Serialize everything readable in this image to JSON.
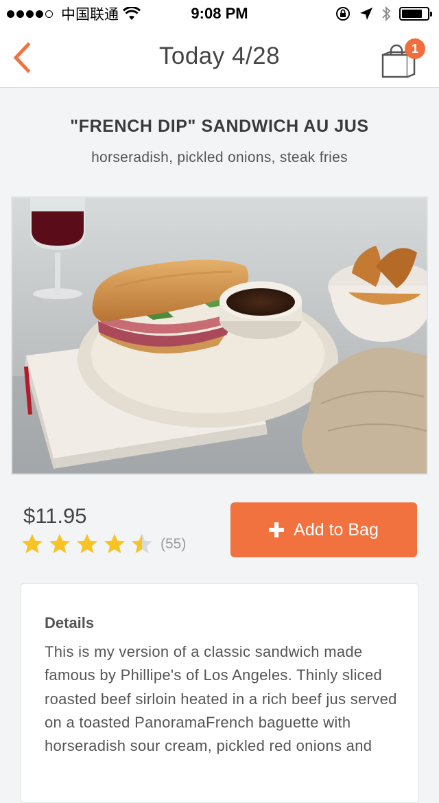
{
  "status_bar": {
    "carrier": "中国联通",
    "time": "9:08 PM",
    "signal_bars_filled": 4,
    "signal_bars_total": 5,
    "battery_level": 0.8
  },
  "nav": {
    "title": "Today 4/28",
    "back_icon": "chevron-left-icon",
    "bag_icon": "shopping-bag-icon",
    "bag_count": "1"
  },
  "dish": {
    "name": "\"FRENCH DIP\" SANDWICH AU JUS",
    "subtitle": "horseradish, pickled onions, steak fries",
    "price": "$11.95",
    "rating_value": 4.5,
    "rating_max": 5,
    "rating_count": "(55)"
  },
  "actions": {
    "add_to_bag_label": "Add to Bag"
  },
  "details": {
    "heading": "Details",
    "body": "This is my version of a classic sandwich made famous by Phillipe's of Los Angeles. Thinly sliced roasted beef sirloin heated in a rich beef jus served on a toasted PanoramaFrench baguette with horseradish sour cream, pickled red onions and"
  },
  "colors": {
    "accent": "#f2723f",
    "badge": "#f26d3d",
    "star": "#f7c325",
    "star_empty": "#d9d9d9"
  }
}
